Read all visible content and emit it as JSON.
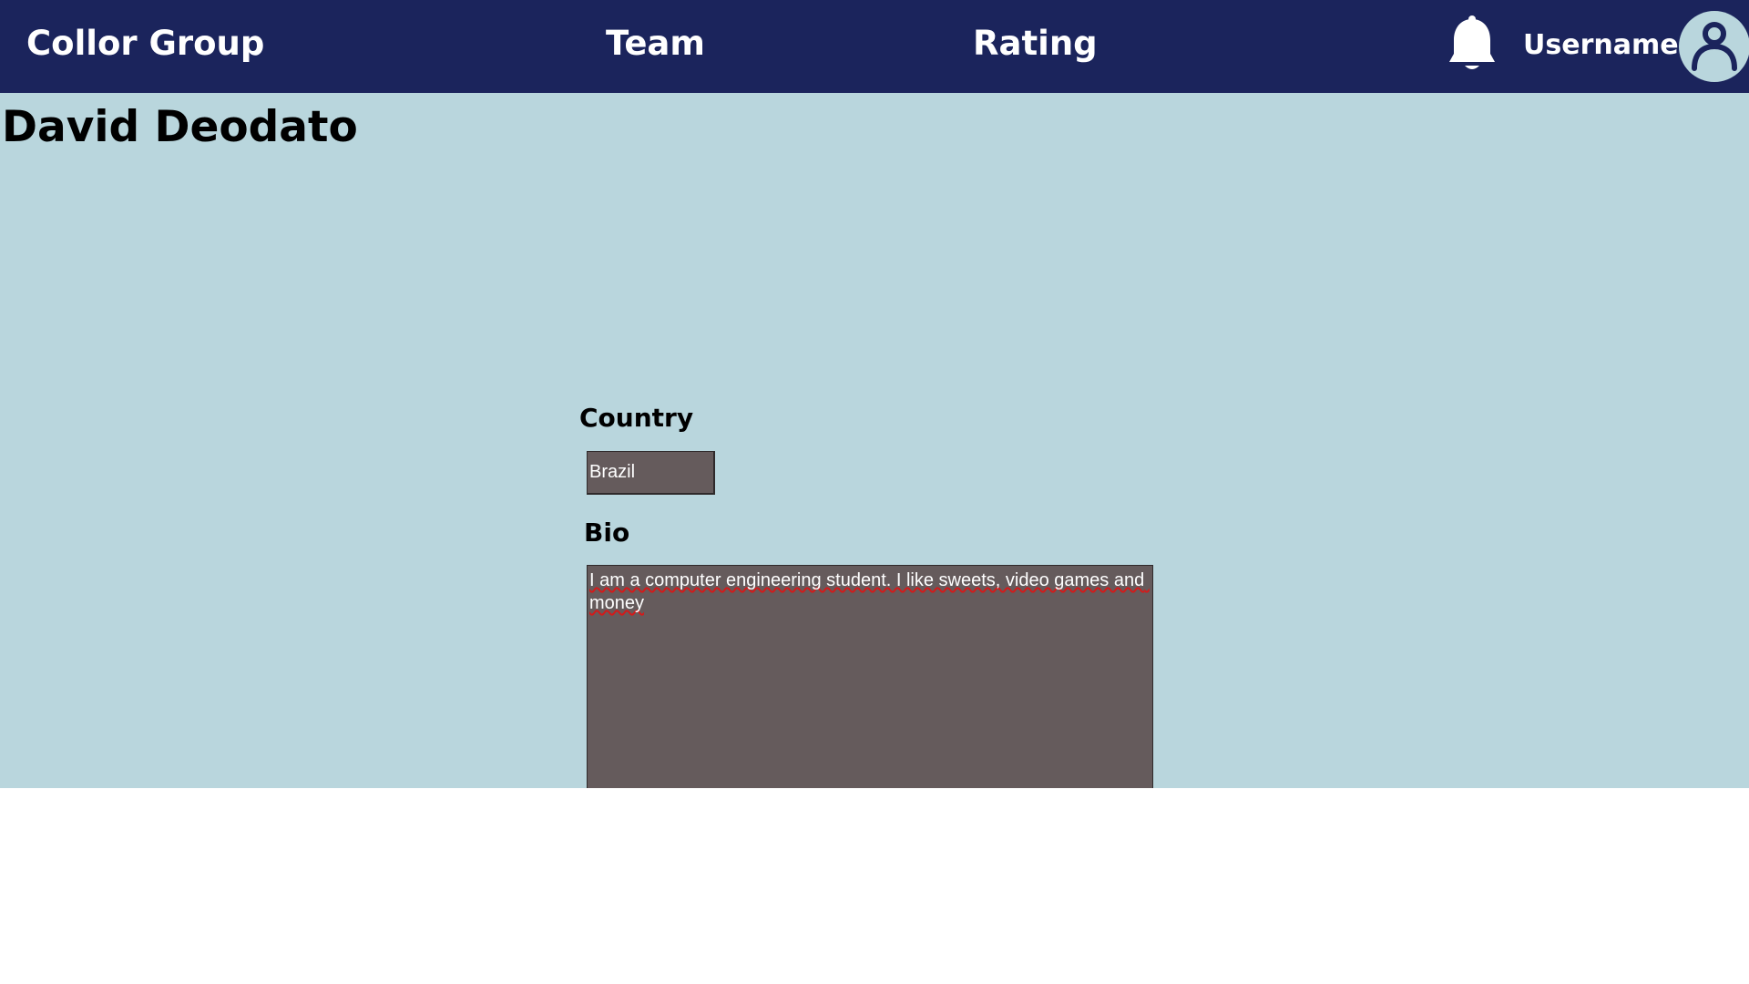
{
  "header": {
    "brand": "Collor Group",
    "nav": {
      "team": "Team",
      "rating": "Rating"
    },
    "username": "Username",
    "icons": {
      "notifications": "bell-icon",
      "profile": "user-avatar-icon"
    },
    "colors": {
      "background": "#1b245c",
      "text": "#ffffff"
    }
  },
  "profile": {
    "name": "David Deodato",
    "country_label": "Country",
    "country_value": "Brazil",
    "bio_label": "Bio",
    "bio_value": "I am a computer engineering student. I like sweets, video games and money"
  },
  "colors": {
    "page_background": "#b9d6dd",
    "field_background": "#655b5c",
    "field_text": "#ffffff",
    "spellcheck_underline": "#d11b1b"
  }
}
